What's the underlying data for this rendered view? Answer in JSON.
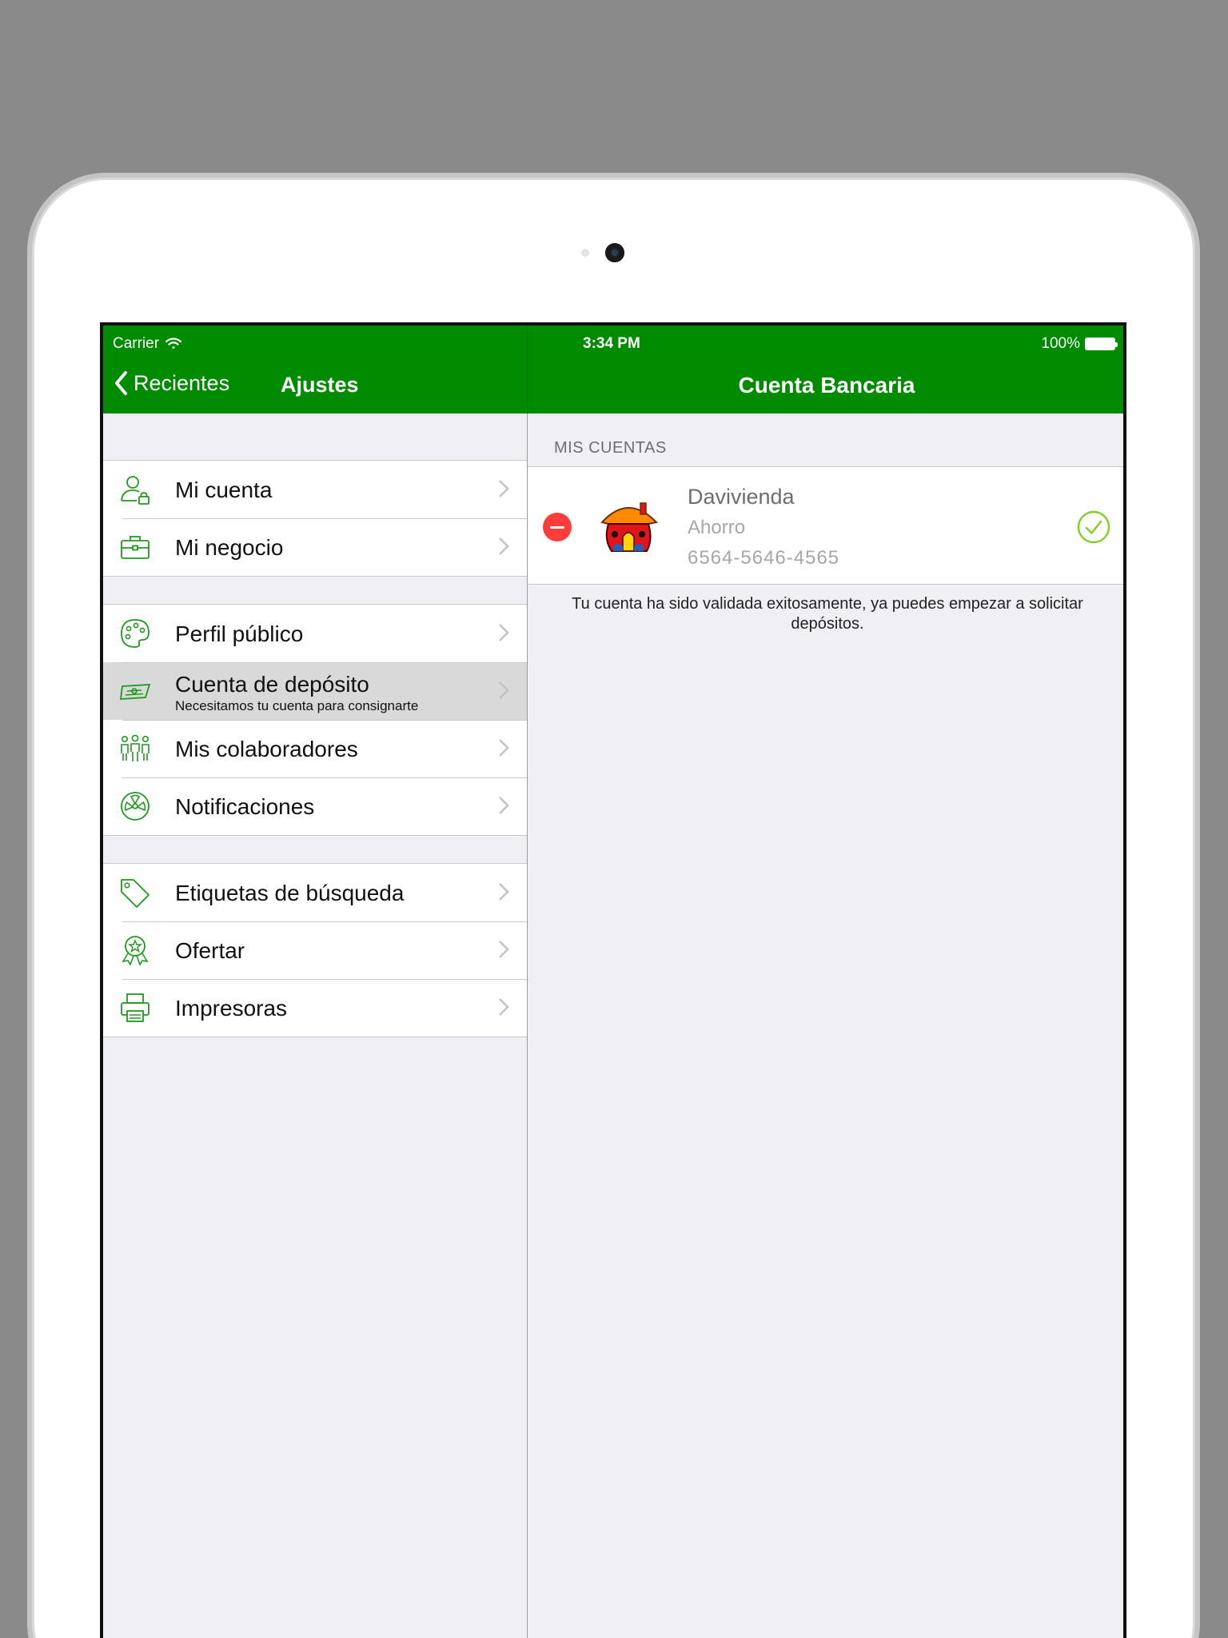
{
  "status_bar": {
    "carrier": "Carrier",
    "time": "3:34 PM",
    "battery": "100%"
  },
  "master_nav": {
    "back_label": "Recientes",
    "title": "Ajustes"
  },
  "detail_nav": {
    "title": "Cuenta Bancaria"
  },
  "settings_groups": [
    [
      {
        "label": "Mi cuenta",
        "icon": "user-lock-icon"
      },
      {
        "label": "Mi negocio",
        "icon": "briefcase-icon"
      }
    ],
    [
      {
        "label": "Perfil público",
        "icon": "palette-icon"
      },
      {
        "label": "Cuenta de depósito",
        "subtitle": "Necesitamos tu cuenta para consignarte",
        "icon": "money-transfer-icon",
        "selected": true
      },
      {
        "label": "Mis colaboradores",
        "icon": "people-icon"
      },
      {
        "label": "Notificaciones",
        "icon": "radiation-icon"
      }
    ],
    [
      {
        "label": "Etiquetas de búsqueda",
        "icon": "tag-icon"
      },
      {
        "label": "Ofertar",
        "icon": "award-star-icon"
      },
      {
        "label": "Impresoras",
        "icon": "printer-icon"
      }
    ]
  ],
  "accounts": {
    "section_header": "MIS CUENTAS",
    "items": [
      {
        "bank": "Davivienda",
        "type": "Ahorro",
        "number": "6564-5646-4565",
        "logo": "davivienda-house-logo",
        "validated": true
      }
    ],
    "note": "Tu cuenta ha sido validada exitosamente, ya puedes empezar a solicitar depósitos."
  },
  "colors": {
    "brand_green": "#008b00",
    "icon_green": "#1e9a1e",
    "check_green": "#7ed321",
    "delete_red": "#fc3d39"
  }
}
